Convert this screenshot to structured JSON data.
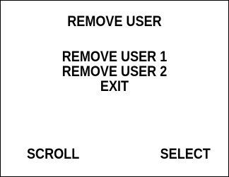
{
  "screen": {
    "title": "REMOVE USER"
  },
  "menu": {
    "items": [
      {
        "label": "REMOVE USER 1"
      },
      {
        "label": "REMOVE USER 2"
      },
      {
        "label": "EXIT"
      }
    ]
  },
  "softkeys": {
    "left_label": "SCROLL",
    "right_label": "SELECT"
  },
  "colors": {
    "background": "#ffffff",
    "text": "#000000",
    "border": "#000000"
  }
}
